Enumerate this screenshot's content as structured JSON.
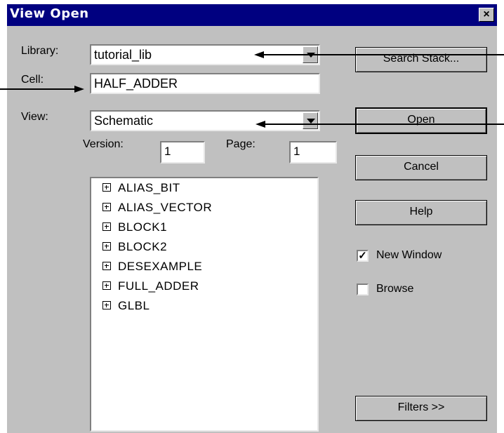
{
  "window": {
    "title": "View Open",
    "close_glyph": "×"
  },
  "library": {
    "label": "Library:",
    "value": "tutorial_lib"
  },
  "cell": {
    "label": "Cell:",
    "value": "HALF_ADDER"
  },
  "view": {
    "label": "View:",
    "value": "Schematic"
  },
  "version": {
    "label": "Version:",
    "value": "1"
  },
  "page": {
    "label": "Page:",
    "value": "1"
  },
  "cell_list": {
    "items": [
      {
        "label": "ALIAS_BIT"
      },
      {
        "label": "ALIAS_VECTOR"
      },
      {
        "label": "BLOCK1"
      },
      {
        "label": "BLOCK2"
      },
      {
        "label": "DESEXAMPLE"
      },
      {
        "label": "FULL_ADDER"
      },
      {
        "label": "GLBL"
      }
    ]
  },
  "buttons": {
    "search_stack": "Search Stack...",
    "open": "Open",
    "cancel": "Cancel",
    "help": "Help",
    "filters": "Filters >>"
  },
  "checkboxes": {
    "new_window": {
      "label": "New Window",
      "checked": true,
      "mark": "✓"
    },
    "browse": {
      "label": "Browse",
      "checked": false
    }
  },
  "colors": {
    "titlebar": "#000080",
    "dialog": "#c0c0c0"
  }
}
